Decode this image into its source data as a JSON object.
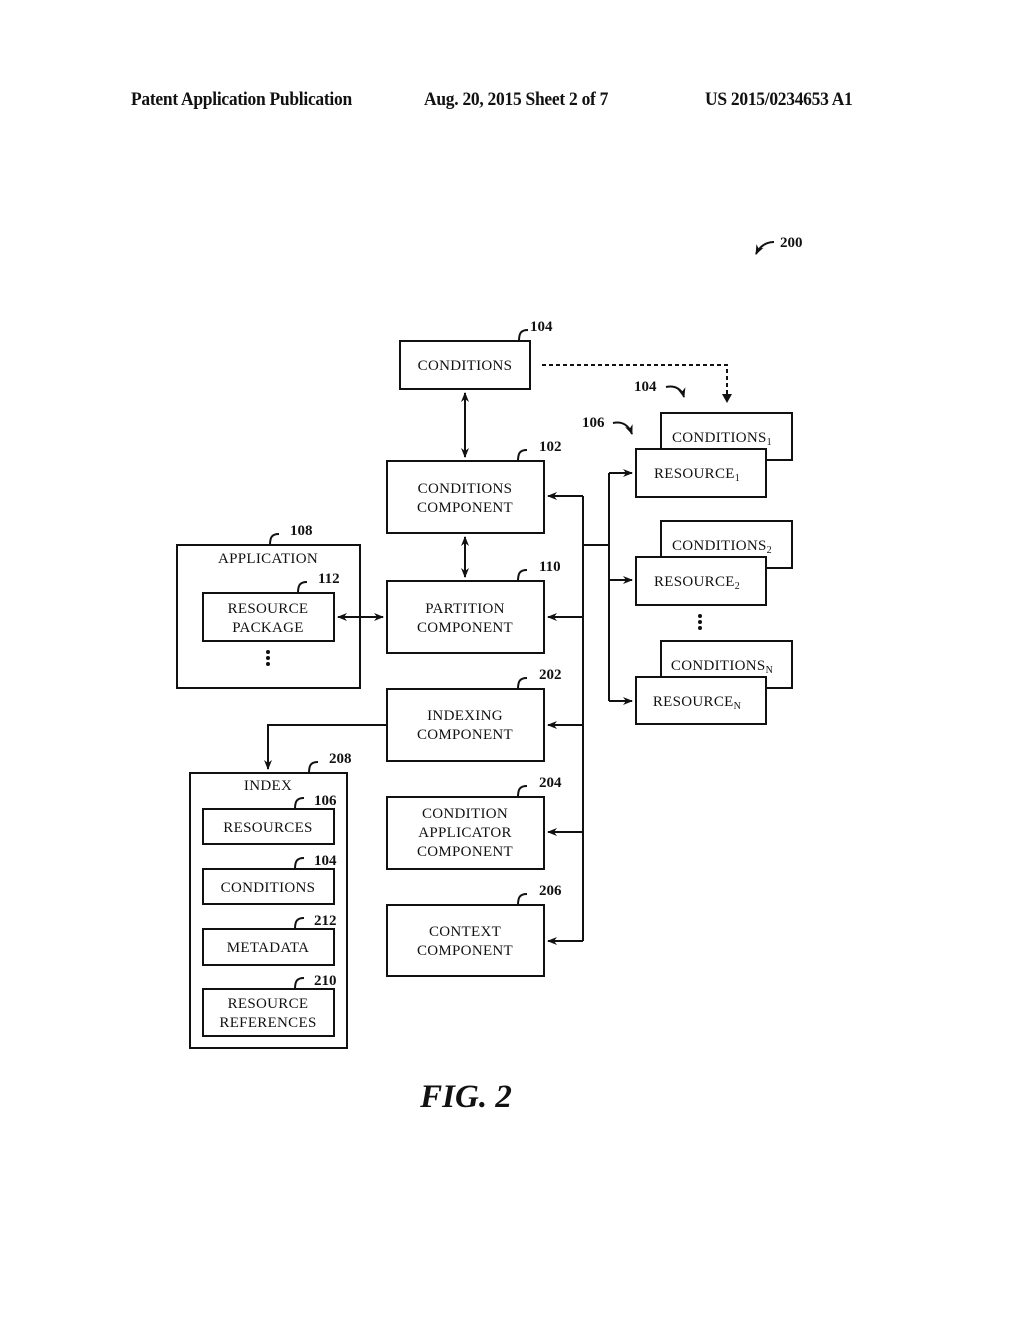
{
  "header": {
    "publication": "Patent Application Publication",
    "date_sheet": "Aug. 20, 2015  Sheet 2 of 7",
    "number": "US 2015/0234653 A1"
  },
  "figure": {
    "ref": "200",
    "caption": "FIG. 2"
  },
  "blocks": {
    "conditions": {
      "ref": "104",
      "lines": [
        "CONDITIONS"
      ]
    },
    "conditions_component": {
      "ref": "102",
      "lines": [
        "CONDITIONS",
        "COMPONENT"
      ]
    },
    "partition_component": {
      "ref": "110",
      "lines": [
        "PARTITION",
        "COMPONENT"
      ]
    },
    "indexing_component": {
      "ref": "202",
      "lines": [
        "INDEXING",
        "COMPONENT"
      ]
    },
    "condition_applicator_component": {
      "ref": "204",
      "lines": [
        "CONDITION",
        "APPLICATOR",
        "COMPONENT"
      ]
    },
    "context_component": {
      "ref": "206",
      "lines": [
        "CONTEXT",
        "COMPONENT"
      ]
    },
    "application": {
      "ref": "108",
      "label": "APPLICATION"
    },
    "resource_package": {
      "ref": "112",
      "lines": [
        "RESOURCE",
        "PACKAGE"
      ]
    },
    "index": {
      "ref": "208",
      "label": "INDEX"
    },
    "index_resources": {
      "ref": "106",
      "lines": [
        "RESOURCES"
      ]
    },
    "index_conditions": {
      "ref": "104",
      "lines": [
        "CONDITIONS"
      ]
    },
    "index_metadata": {
      "ref": "212",
      "lines": [
        "METADATA"
      ]
    },
    "index_resource_references": {
      "ref": "210",
      "lines": [
        "RESOURCE",
        "REFERENCES"
      ]
    }
  },
  "resource_stack": {
    "conditions_ref": "104",
    "resources_ref": "106",
    "items": [
      {
        "conditions": "CONDITIONS",
        "conditions_sub": "1",
        "resource": "RESOURCE",
        "resource_sub": "1"
      },
      {
        "conditions": "CONDITIONS",
        "conditions_sub": "2",
        "resource": "RESOURCE",
        "resource_sub": "2"
      },
      {
        "conditions": "CONDITIONS",
        "conditions_sub": "N",
        "resource": "RESOURCE",
        "resource_sub": "N"
      }
    ],
    "ellipsis": "⋮"
  },
  "application_ellipsis": "⋮"
}
